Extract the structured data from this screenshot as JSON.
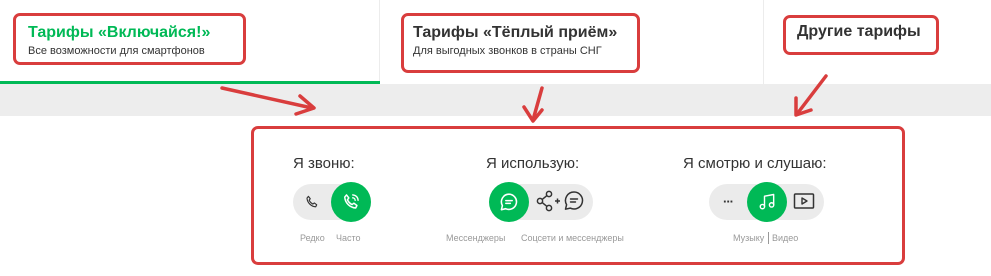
{
  "tabs": [
    {
      "title": "Тарифы «Включайся!»",
      "subtitle": "Все возможности для смартфонов",
      "active": true
    },
    {
      "title": "Тарифы «Тёплый приём»",
      "subtitle": "Для выгодных звонков в страны СНГ",
      "active": false
    },
    {
      "title": "Другие тарифы",
      "subtitle": "",
      "active": false
    }
  ],
  "groups": {
    "call": {
      "title": "Я звоню:",
      "options": [
        "Редко",
        "Часто"
      ],
      "selected": "Часто"
    },
    "use": {
      "title": "Я использую:",
      "options": [
        "Мессенджеры",
        "Соцсети и мессенджеры"
      ],
      "selected": "Мессенджеры"
    },
    "watch": {
      "title": "Я смотрю и слушаю:",
      "options": [
        "Музыку",
        "Видео"
      ],
      "selected": "Музыку",
      "more_glyph": "···"
    }
  },
  "icons": {
    "phone": "phone-icon",
    "phone_active": "phone-calling-icon",
    "messenger": "chat-bubble-icon",
    "social": "share-nodes-icon",
    "more": "more-icon",
    "music": "music-note-icon",
    "video": "video-play-icon"
  },
  "colors": {
    "accent": "#00b956",
    "annotation": "#d93d3d",
    "band": "#ededed",
    "pill": "#ebebeb"
  }
}
